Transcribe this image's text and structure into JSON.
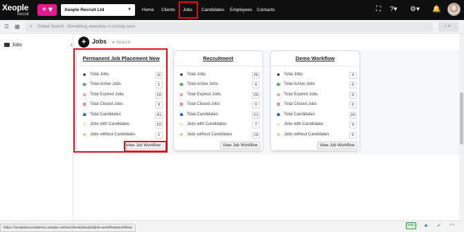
{
  "topbar": {
    "logo_brand": "Xeople",
    "logo_sub": "recruit",
    "plus_label": "+ ▾",
    "company": "Xeople Recruit Ltd",
    "nav": [
      "Home",
      "Clients",
      "Jobs",
      "Candidates",
      "Employees",
      "Contacts"
    ],
    "active_nav": "Jobs"
  },
  "subbar": {
    "search_placeholder": "Global Search - Something awesome is coming soon"
  },
  "sidebar": {
    "items": [
      {
        "label": "Jobs"
      }
    ]
  },
  "page": {
    "title": "Jobs",
    "search_placeholder": "Search"
  },
  "cards": [
    {
      "title": "Permanent Job Placement New",
      "stats": [
        {
          "label": "Total Jobs",
          "value": "11",
          "icon": "briefcase-icon"
        },
        {
          "label": "Total Active Jobs",
          "value": "1",
          "icon": "active-jobs-icon"
        },
        {
          "label": "Total Expired Jobs",
          "value": "10",
          "icon": "expired-jobs-icon"
        },
        {
          "label": "Total Closed Jobs",
          "value": "0",
          "icon": "closed-jobs-icon"
        },
        {
          "label": "Total Candidates",
          "value": "41",
          "icon": "candidates-icon"
        },
        {
          "label": "Jobs with Candidates",
          "value": "10",
          "icon": "jobs-with-candidates-icon"
        },
        {
          "label": "Jobs without Candidates",
          "value": "1",
          "icon": "jobs-without-candidates-icon"
        }
      ],
      "button": "View Job Workflow"
    },
    {
      "title": "Recruitment",
      "stats": [
        {
          "label": "Total Jobs",
          "value": "26",
          "icon": "briefcase-icon"
        },
        {
          "label": "Total Active Jobs",
          "value": "0",
          "icon": "active-jobs-icon"
        },
        {
          "label": "Total Expired Jobs",
          "value": "26",
          "icon": "expired-jobs-icon"
        },
        {
          "label": "Total Closed Jobs",
          "value": "0",
          "icon": "closed-jobs-icon"
        },
        {
          "label": "Total Candidates",
          "value": "21",
          "icon": "candidates-icon"
        },
        {
          "label": "Jobs with Candidates",
          "value": "7",
          "icon": "jobs-with-candidates-icon"
        },
        {
          "label": "Jobs without Candidates",
          "value": "19",
          "icon": "jobs-without-candidates-icon"
        }
      ],
      "button": "View Job Workflow"
    },
    {
      "title": "Demo Workflow",
      "stats": [
        {
          "label": "Total Jobs",
          "value": "3",
          "icon": "briefcase-icon"
        },
        {
          "label": "Total Active Jobs",
          "value": "0",
          "icon": "active-jobs-icon"
        },
        {
          "label": "Total Expired Jobs",
          "value": "3",
          "icon": "expired-jobs-icon"
        },
        {
          "label": "Total Closed Jobs",
          "value": "0",
          "icon": "closed-jobs-icon"
        },
        {
          "label": "Total Candidates",
          "value": "20",
          "icon": "candidates-icon"
        },
        {
          "label": "Jobs with Candidates",
          "value": "3",
          "icon": "jobs-with-candidates-icon"
        },
        {
          "label": "Jobs without Candidates",
          "value": "0",
          "icon": "jobs-without-candidates-icon"
        }
      ],
      "button": "View Job Workflow"
    }
  ],
  "statusbar": {
    "url": "https://xeoplerecruitdemo.xeople.online/client/jobs/job/job-workflow/workflow",
    "ppd_label": "PPD"
  },
  "colors": {
    "accent": "#e6198c",
    "highlight": "#e0101a",
    "topbar": "#0f0f0f"
  }
}
